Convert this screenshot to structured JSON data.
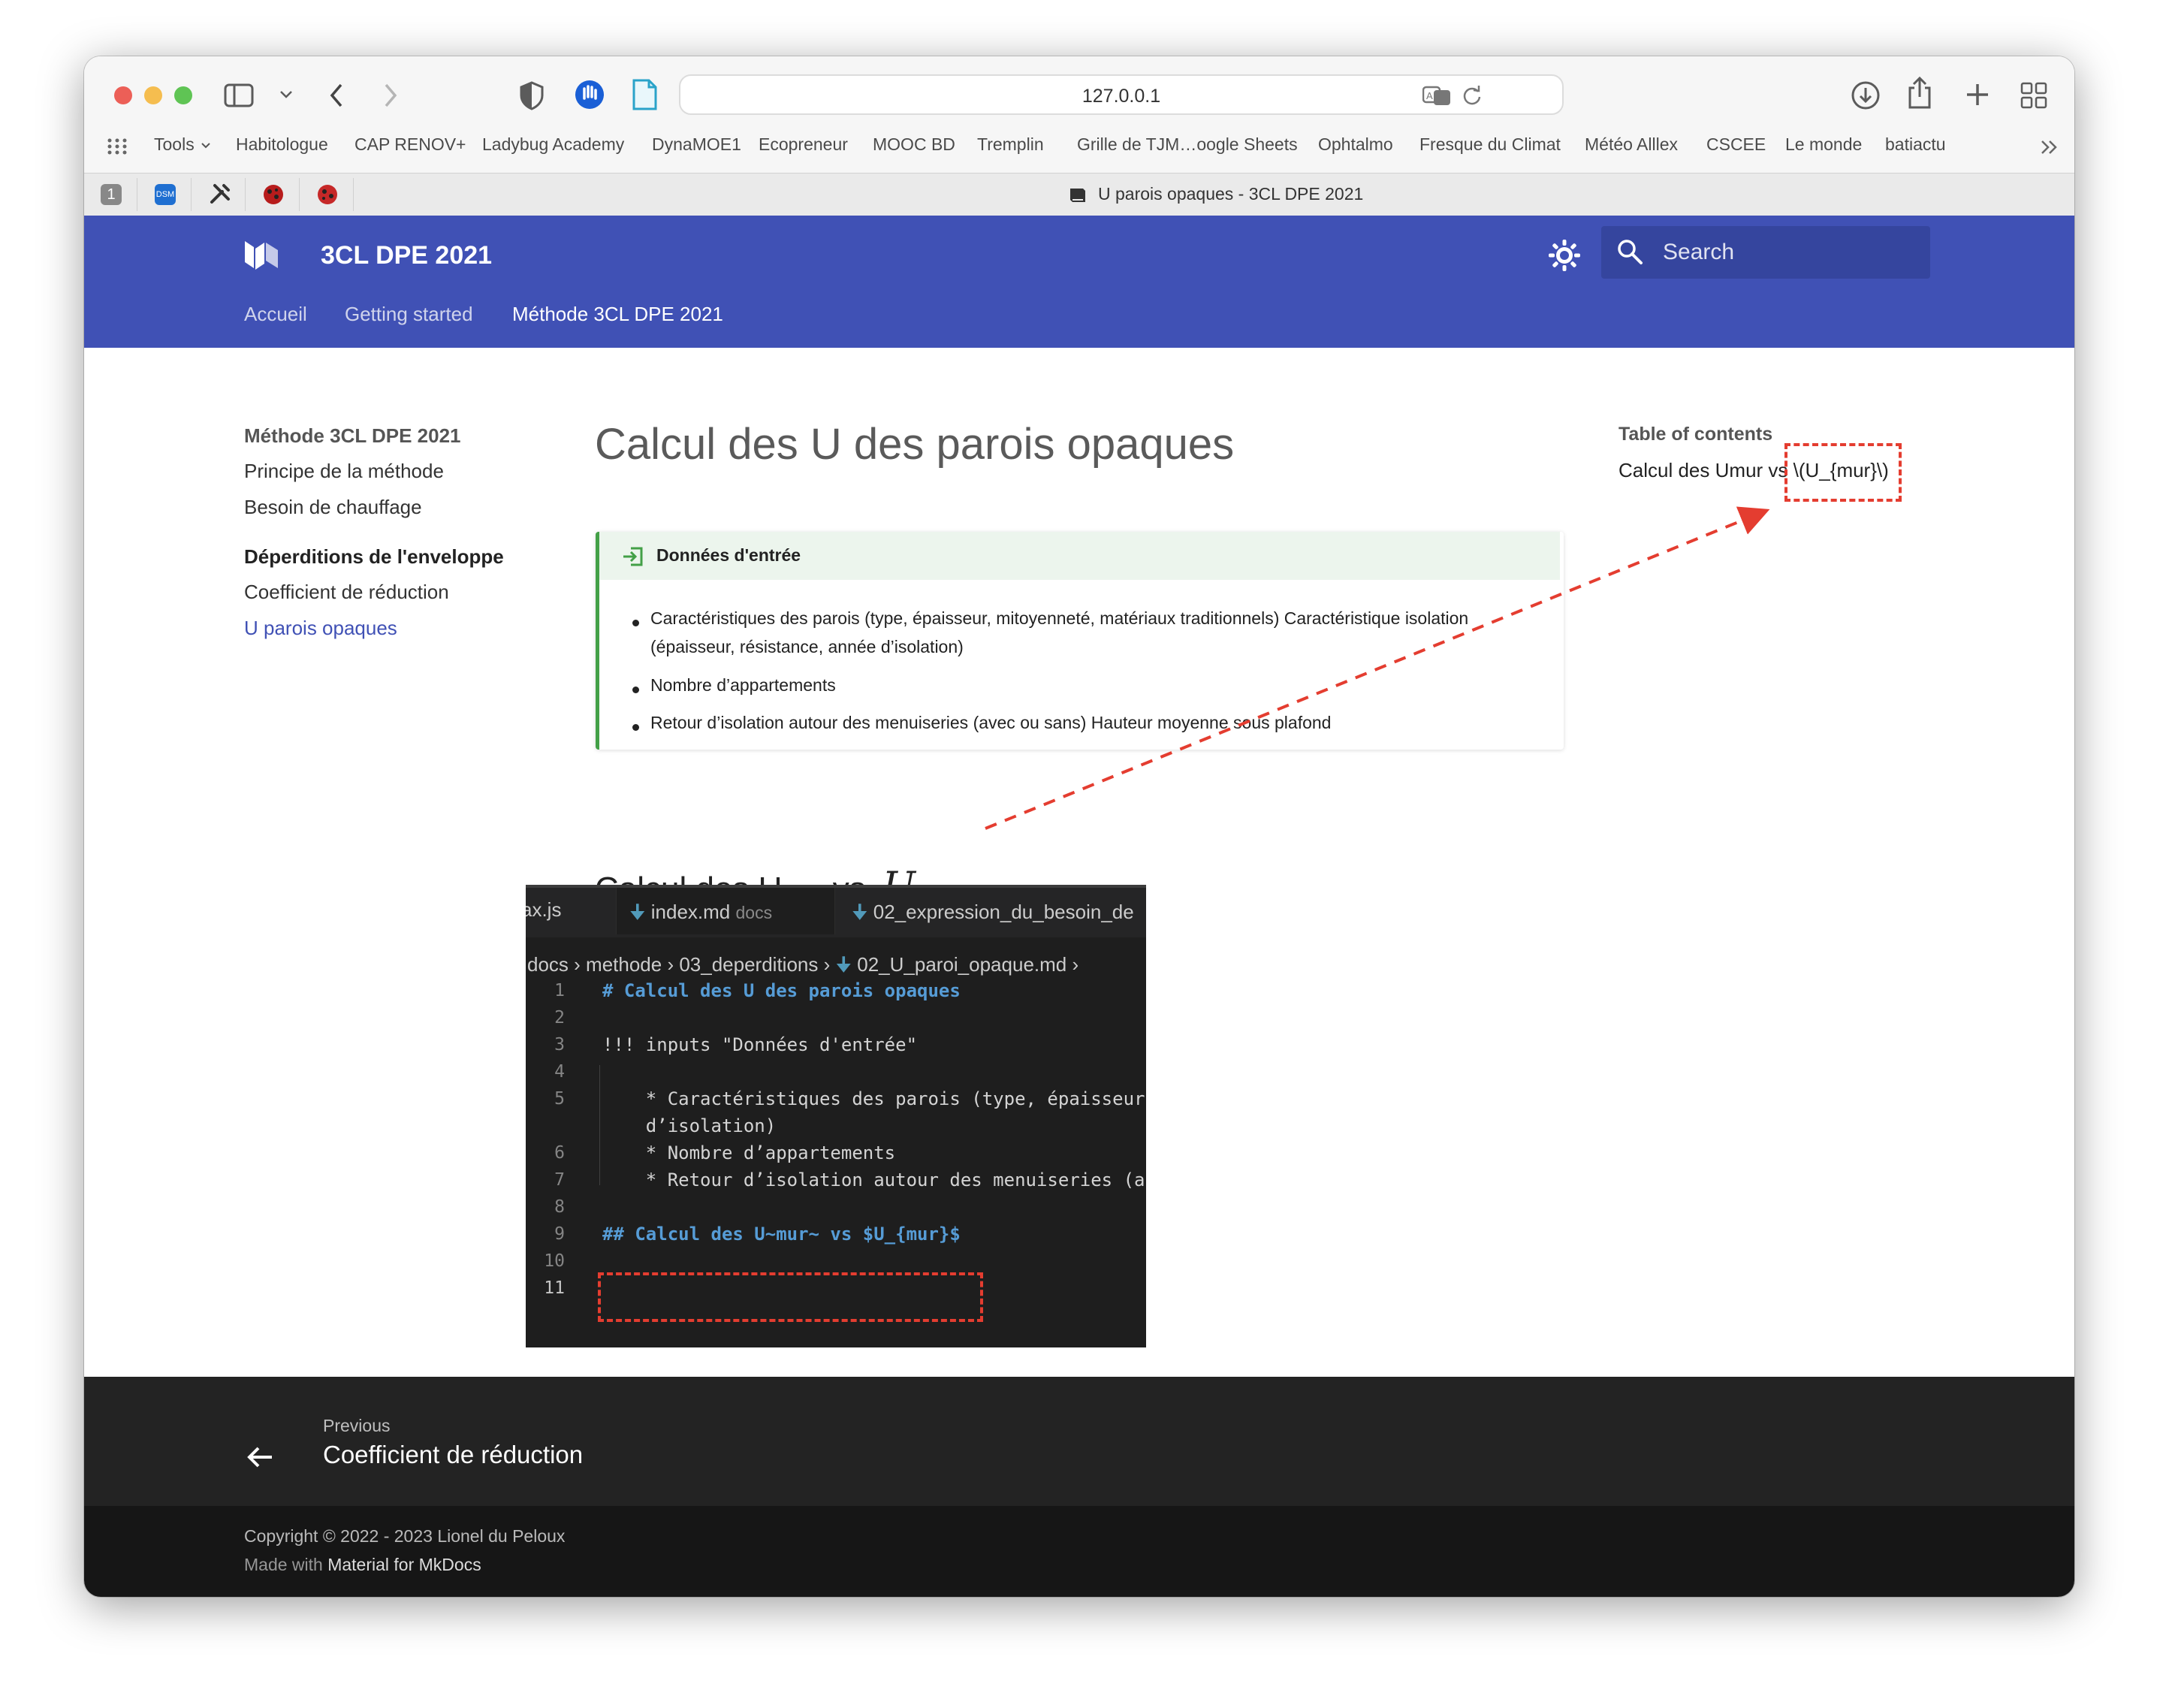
{
  "browser": {
    "address": "127.0.0.1",
    "tab_title": "U parois opaques - 3CL DPE 2021",
    "bookmarks": [
      "Tools",
      "Habitologue",
      "CAP RENOV+",
      "Ladybug Academy",
      "DynaMOE1",
      "Ecopreneur",
      "MOOC BD",
      "Tremplin",
      "Grille de TJM…oogle Sheets",
      "Ophtalmo",
      "Fresque du Climat",
      "Météo Alllex",
      "CSCEE",
      "Le monde",
      "batiactu"
    ],
    "pinned_tabs": [
      "1",
      "DSM"
    ]
  },
  "site": {
    "title": "3CL DPE 2021",
    "search_placeholder": "Search",
    "tabs": [
      "Accueil",
      "Getting started",
      "Méthode 3CL DPE 2021"
    ]
  },
  "nav": {
    "section": "Méthode 3CL DPE 2021",
    "items": [
      "Principe de la méthode",
      "Besoin de chauffage"
    ],
    "group": "Déperditions de l'enveloppe",
    "sub_items": [
      "Coefficient de réduction",
      "U parois opaques"
    ]
  },
  "content": {
    "title": "Calcul des U des parois opaques",
    "admonition": {
      "title": "Données d'entrée",
      "items": [
        "Caractéristiques des parois (type, épaisseur, mitoyenneté, matériaux traditionnels) Caractéristique isolation (épaisseur, résistance, année d’isolation)",
        "Nombre d’appartements",
        "Retour d’isolation autour des menuiseries (avec ou sans) Hauteur moyenne sous plafond"
      ]
    },
    "h2": {
      "text": "Calcul des U",
      "sub": "mur",
      "vs": "vs",
      "math": "U",
      "math_sub": "mur"
    }
  },
  "editor": {
    "tabs": [
      {
        "name": "ax.js",
        "hint": ""
      },
      {
        "name": "index.md",
        "hint": "docs"
      },
      {
        "name": "02_expression_du_besoin_de",
        "hint": ""
      }
    ],
    "breadcrumb": [
      "docs",
      "methode",
      "03_deperditions",
      "02_U_paroi_opaque.md"
    ],
    "lines": [
      {
        "n": "1",
        "text": "# Calcul des U des parois opaques"
      },
      {
        "n": "2",
        "text": ""
      },
      {
        "n": "3",
        "text": "!!! inputs \"Données d'entrée\""
      },
      {
        "n": "4",
        "text": ""
      },
      {
        "n": "5",
        "text": "    * Caractéristiques des parois (type, épaisseur"
      },
      {
        "n": "",
        "text": "    d’isolation)"
      },
      {
        "n": "6",
        "text": "    * Nombre d’appartements"
      },
      {
        "n": "7",
        "text": "    * Retour d’isolation autour des menuiseries (a"
      },
      {
        "n": "8",
        "text": ""
      },
      {
        "n": "9",
        "text": "## Calcul des U~mur~ vs $U_{mur}$"
      },
      {
        "n": "10",
        "text": ""
      },
      {
        "n": "11",
        "text": ""
      }
    ]
  },
  "toc": {
    "title": "Table of contents",
    "item_prefix": "Calcul des U",
    "item_sub": "mur",
    "item_suffix": " vs ",
    "item_raw": "\\(U_{mur}\\)"
  },
  "footer": {
    "prev_label": "Previous",
    "prev_title": "Coefficient de réduction",
    "copyright": "Copyright © 2022 - 2023 Lionel du Peloux",
    "made_with": "Made with ",
    "made_with_link": "Material for MkDocs"
  },
  "colors": {
    "header": "#4051b5",
    "accent": "#4051b5",
    "annotation": "#e43d30",
    "admonition": "#43a047"
  }
}
